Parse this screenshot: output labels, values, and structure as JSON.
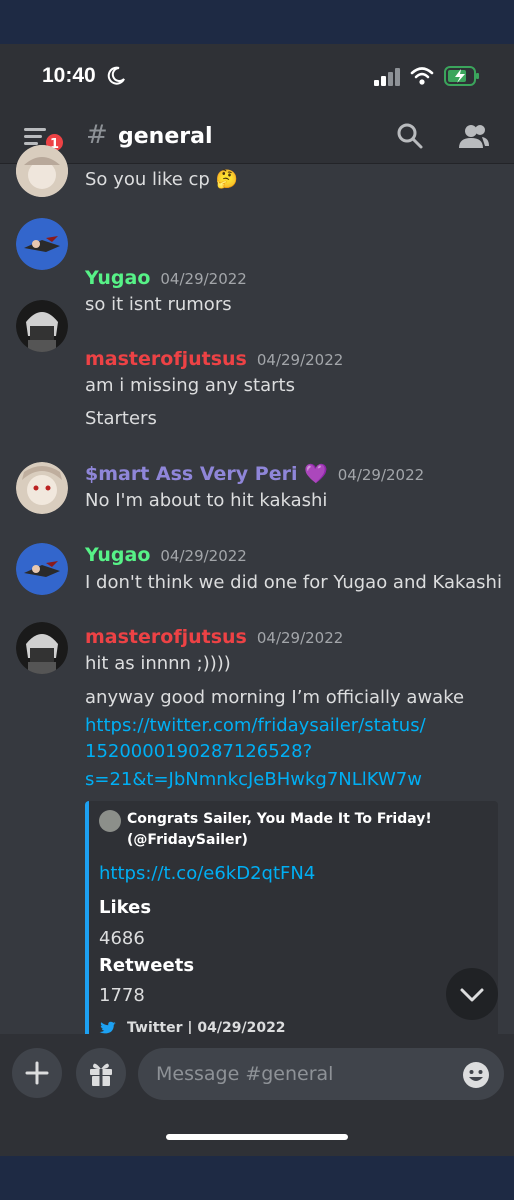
{
  "status_bar": {
    "time": "10:40"
  },
  "header": {
    "badge_count": "1",
    "channel_hash": "#",
    "channel_name": "general"
  },
  "messages": [
    {
      "text": "So you like cp 🤔"
    },
    {
      "username": "Yugao",
      "timestamp": "04/29/2022",
      "lines": [
        "so it isnt rumors"
      ],
      "color": "#57f287"
    },
    {
      "username": "masterofjutsus",
      "timestamp": "04/29/2022",
      "lines": [
        "am i missing any starts",
        "Starters"
      ],
      "color": "#ed4245"
    },
    {
      "username": "$mart Ass Very Peri 💜",
      "timestamp": "04/29/2022",
      "lines": [
        "No I'm about to hit kakashi"
      ],
      "color": "#8f86d9"
    },
    {
      "username": "Yugao",
      "timestamp": "04/29/2022",
      "lines": [
        "I don't think we did one for Yugao and Kakashi"
      ],
      "color": "#57f287"
    },
    {
      "username": "masterofjutsus",
      "timestamp": "04/29/2022",
      "lines": [
        "hit as innnn ;))))",
        "anyway good morning I’m officially awake"
      ],
      "link_lines": [
        "https://twitter.com/fridaysailer/status/",
        "1520000190287126528?",
        "s=21&t=JbNmnkcJeBHwkg7NLlKW7w"
      ],
      "color": "#ed4245"
    }
  ],
  "embed": {
    "author_line1": "Congrats Sailer, You Made It To Friday!",
    "author_line2": "(@FridaySailer)",
    "description": "https://t.co/e6kD2qtFN4",
    "fields": [
      {
        "name": "Likes",
        "value": "4686"
      },
      {
        "name": "Retweets",
        "value": "1778"
      }
    ],
    "footer": "Twitter | 04/29/2022",
    "accent": "#1da1f2"
  },
  "input": {
    "placeholder": "Message #general"
  },
  "icons": [
    "menu-icon",
    "search-icon",
    "members-icon",
    "plus-icon",
    "gift-icon",
    "emoji-icon",
    "chevron-down-icon",
    "twitter-icon",
    "moon-icon",
    "signal-icon",
    "wifi-icon",
    "battery-icon"
  ]
}
